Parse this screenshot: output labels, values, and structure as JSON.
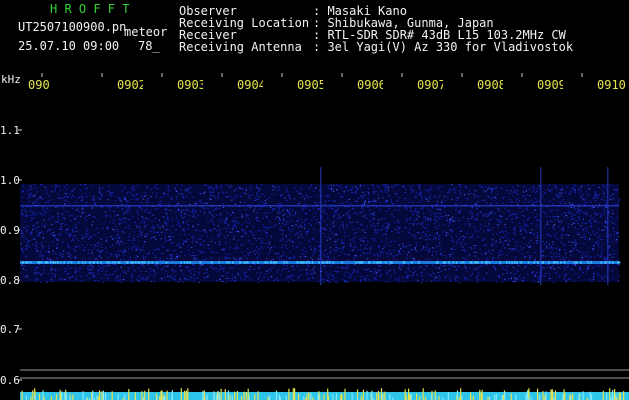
{
  "header": {
    "app_title": "H R O F F T",
    "filename": "UT2507100900.pn",
    "meteor_label": "meteor",
    "datetime": "25.07.10 09:00",
    "meteor_count": "78_",
    "info_labels": [
      "Observer",
      "Receiving Location",
      "Receiver",
      "Receiving Antenna"
    ],
    "info_values": [
      ": Masaki Kano",
      ": Shibukawa, Gunma, Japan",
      ": RTL-SDR SDR# 43dB L15 103.2MHz CW",
      ": 3el Yagi(V) Az 330 for Vladivostok"
    ]
  },
  "plot": {
    "y_unit": "kHz",
    "y_ticks": [
      "1.1",
      "1.0",
      "0.9",
      "0.8",
      "0.7",
      "0.6"
    ],
    "x_ticks": [
      "090",
      "0902",
      "0903",
      "0904",
      "0905",
      "0906",
      "0907",
      "0908",
      "0909",
      "0910"
    ]
  },
  "colors": {
    "background": "#000000",
    "text": "#f2f2f2",
    "title_green": "#37d337",
    "tick_yellow": "#e6e64a",
    "noise_blue": "#1a2bd6",
    "line_cyan": "#49c7ff",
    "bottom_bar_cyan": "#2fc4ea"
  }
}
